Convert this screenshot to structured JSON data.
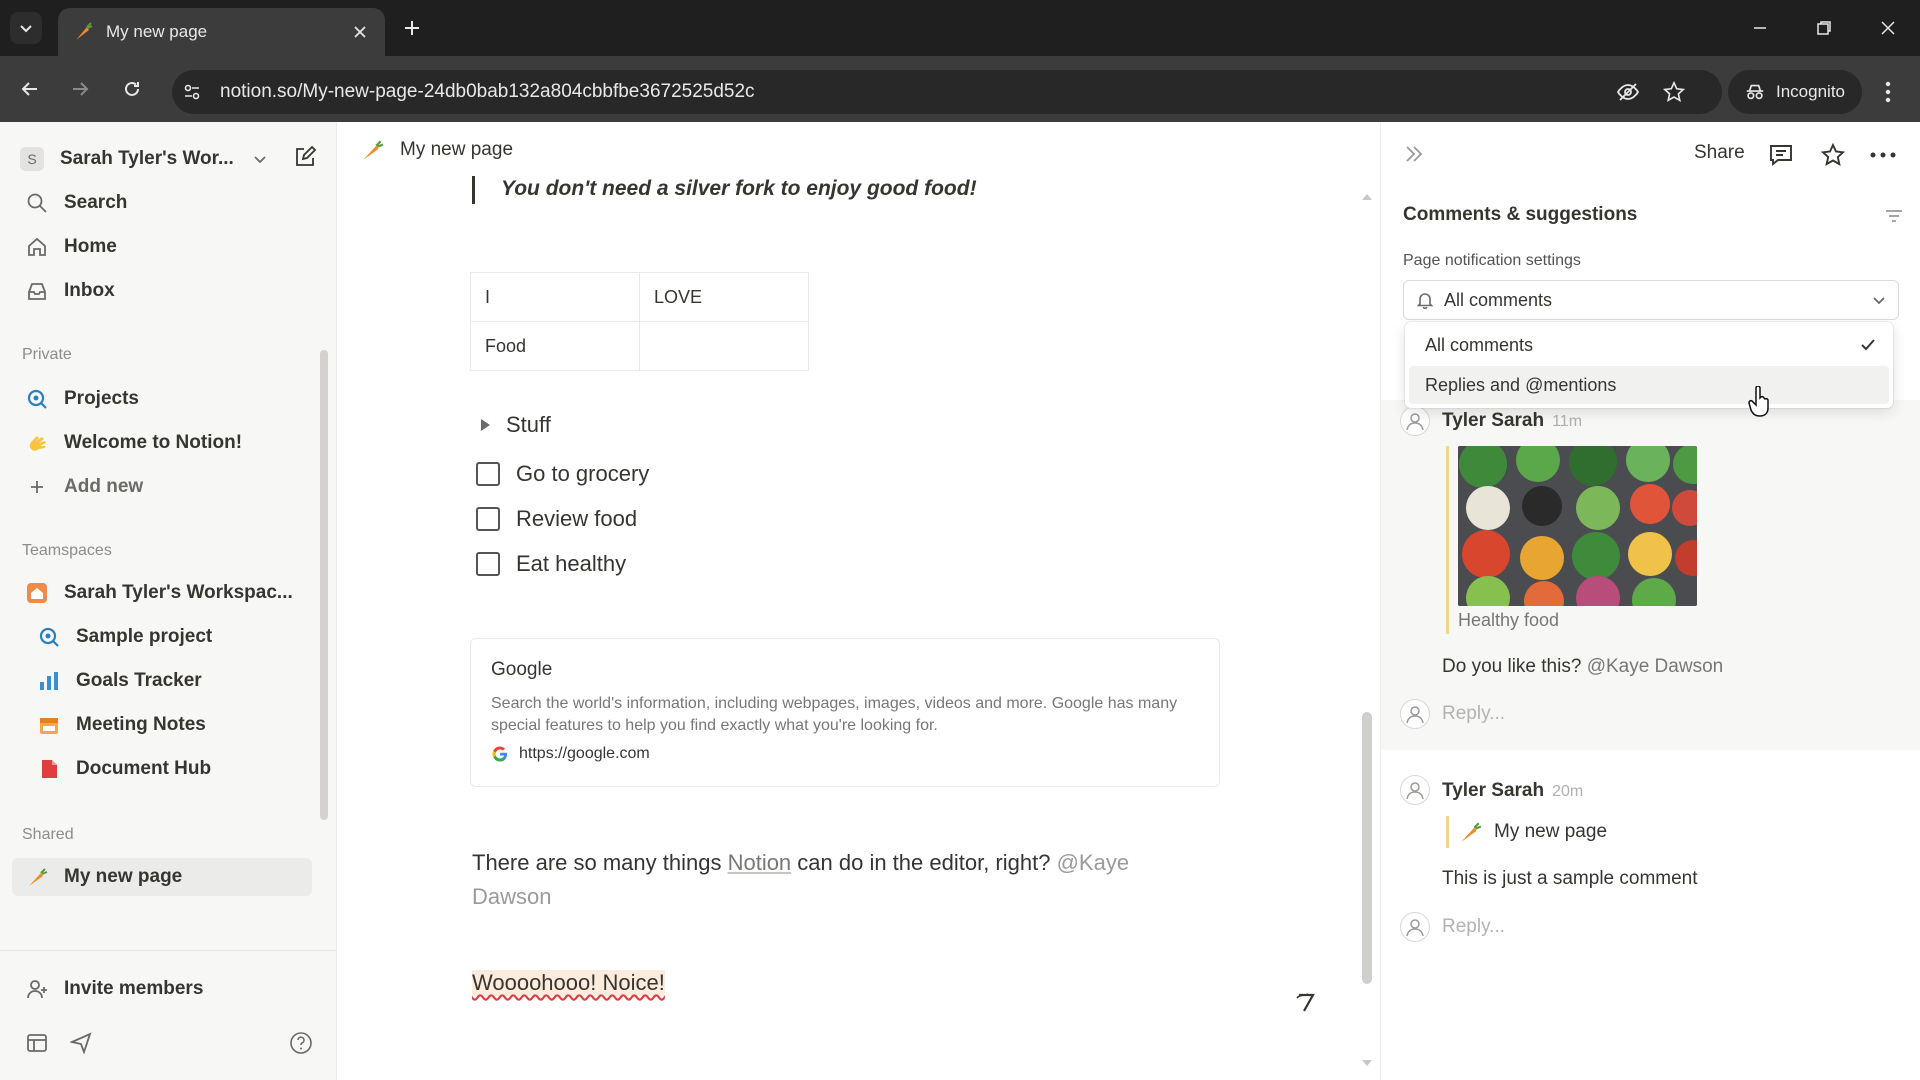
{
  "browser": {
    "tab_title": "My new page",
    "url": "notion.so/My-new-page-24db0bab132a804cbbfbe3672525d52c",
    "incognito_label": "Incognito"
  },
  "sidebar": {
    "workspace_initial": "S",
    "workspace_name": "Sarah Tyler's Wor...",
    "top_items": [
      {
        "label": "Search",
        "icon": "search-icon"
      },
      {
        "label": "Home",
        "icon": "home-icon"
      },
      {
        "label": "Inbox",
        "icon": "inbox-icon"
      }
    ],
    "private_label": "Private",
    "private_items": [
      {
        "label": "Projects",
        "icon": "projects-icon"
      },
      {
        "label": "Welcome to Notion!",
        "icon": "wave-emoji-icon"
      },
      {
        "label": "Add new",
        "icon": "plus-icon"
      }
    ],
    "teamspaces_label": "Teamspaces",
    "teamspace_name": "Sarah Tyler's Workspac...",
    "teamspace_items": [
      {
        "label": "Sample project",
        "icon": "projects-icon"
      },
      {
        "label": "Goals Tracker",
        "icon": "chart-icon"
      },
      {
        "label": "Meeting Notes",
        "icon": "calendar-icon"
      },
      {
        "label": "Document Hub",
        "icon": "document-icon"
      }
    ],
    "shared_label": "Shared",
    "shared_items": [
      {
        "label": "My new page",
        "icon": "carrot-icon"
      }
    ],
    "invite_label": "Invite members"
  },
  "page": {
    "title": "My new page",
    "quote": "You don't need a silver fork to enjoy good food!",
    "table": [
      [
        "I",
        "LOVE"
      ],
      [
        "Food",
        ""
      ]
    ],
    "toggle_label": "Stuff",
    "todos": [
      "Go to grocery",
      "Review food",
      "Eat healthy"
    ],
    "bookmark": {
      "title": "Google",
      "description": "Search the world's information, including webpages, images, videos and more. Google has many special features to help you find exactly what you're looking for.",
      "url": "https://google.com"
    },
    "paragraph": {
      "before": "There are so many things ",
      "link": "Notion",
      "after": " can do in the editor, right? ",
      "mention": "@Kaye Dawson"
    },
    "highlight_text": "Woooohooo! Noice!"
  },
  "panel": {
    "share_label": "Share",
    "title": "Comments & suggestions",
    "notification_label": "Page notification settings",
    "selected_option": "All comments",
    "options": [
      "All comments",
      "Replies and @mentions"
    ],
    "comments": [
      {
        "author": "Tyler Sarah",
        "time": "11m",
        "image_caption": "Healthy food",
        "text": "Do you like this? ",
        "mention": "@Kaye Dawson",
        "reply_placeholder": "Reply..."
      },
      {
        "author": "Tyler Sarah",
        "time": "20m",
        "page_ref": "My new page",
        "text": "This is just a sample comment",
        "reply_placeholder": "Reply..."
      }
    ]
  }
}
